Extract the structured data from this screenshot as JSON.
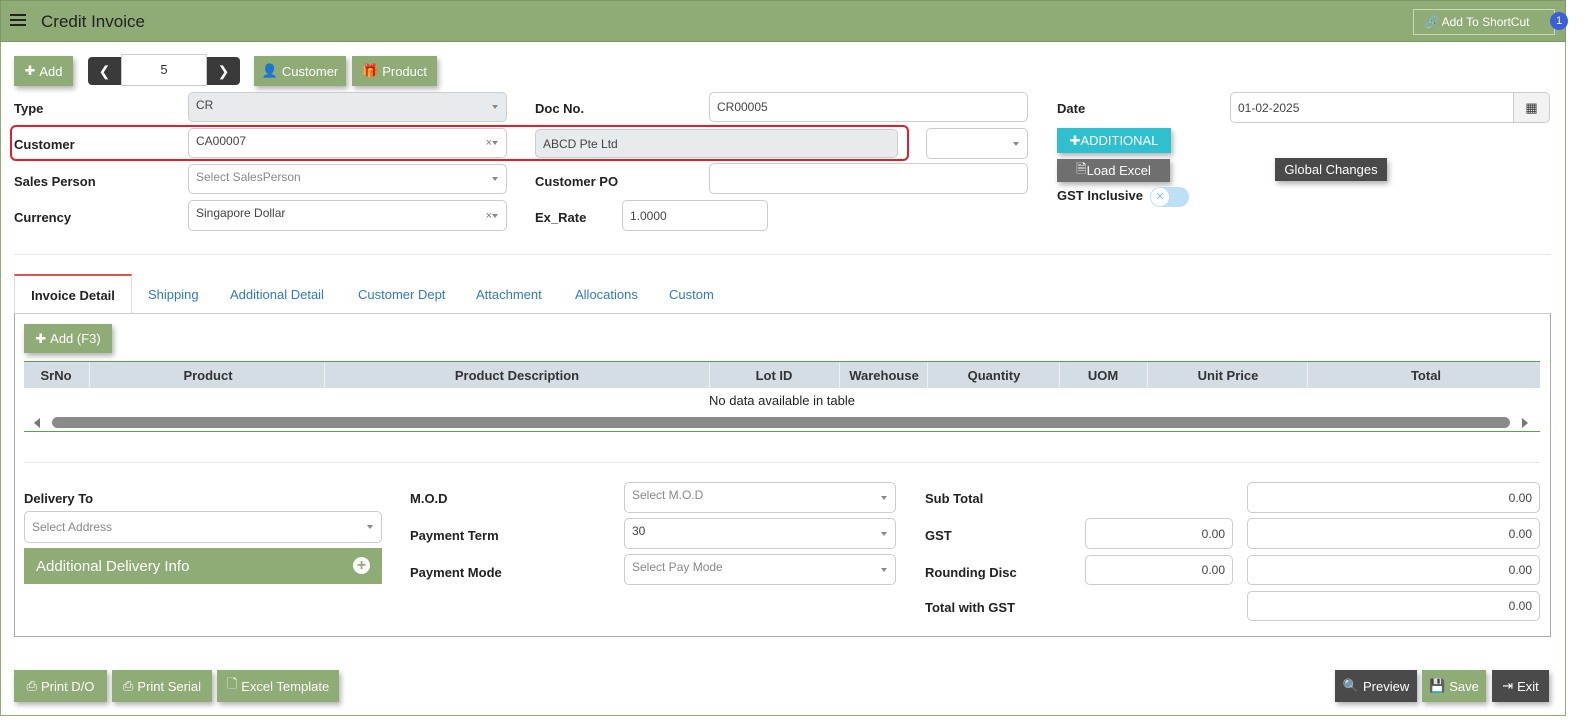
{
  "header": {
    "title": "Credit Invoice",
    "shortcut_label": "Add To ShortCut",
    "badge": "1"
  },
  "toolbar": {
    "add_label": "Add",
    "record_number": "5",
    "customer_label": "Customer",
    "product_label": "Product"
  },
  "form": {
    "type_label": "Type",
    "type_value": "CR",
    "docno_label": "Doc No.",
    "docno_value": "CR00005",
    "date_label": "Date",
    "date_value": "01-02-2025",
    "customer_label": "Customer",
    "customer_code": "CA00007",
    "customer_name": "ABCD Pte Ltd",
    "additional_label": "ADDITIONAL",
    "sales_person_label": "Sales Person",
    "sales_person_placeholder": "Select SalesPerson",
    "customer_po_label": "Customer PO",
    "load_excel_label": "Load Excel",
    "global_changes_label": "Global Changes",
    "gst_inclusive_label": "GST Inclusive",
    "currency_label": "Currency",
    "currency_value": "Singapore Dollar",
    "exrate_label": "Ex_Rate",
    "exrate_value": "1.0000"
  },
  "tabs": [
    "Invoice Detail",
    "Shipping",
    "Additional Detail",
    "Customer Dept",
    "Attachment",
    "Allocations",
    "Custom"
  ],
  "grid": {
    "add_label": "Add (F3)",
    "columns": [
      "SrNo",
      "Product",
      "Product Description",
      "Lot ID",
      "Warehouse",
      "Quantity",
      "UOM",
      "Unit Price",
      "Total"
    ],
    "empty_text": "No data available in table"
  },
  "footer_form": {
    "delivery_label": "Delivery To",
    "delivery_placeholder": "Select Address",
    "additional_delivery_label": "Additional Delivery Info",
    "mod_label": "M.O.D",
    "mod_placeholder": "Select M.O.D",
    "payment_term_label": "Payment Term",
    "payment_term_value": "30",
    "payment_mode_label": "Payment Mode",
    "payment_mode_placeholder": "Select Pay Mode",
    "subtotal_label": "Sub Total",
    "subtotal_value": "0.00",
    "gst_label": "GST",
    "gst_rate_value": "0.00",
    "gst_value": "0.00",
    "rounding_label": "Rounding Disc",
    "rounding_rate_value": "0.00",
    "rounding_value": "0.00",
    "total_gst_label": "Total with GST",
    "total_gst_value": "0.00"
  },
  "actions": {
    "print_do": "Print D/O",
    "print_serial": "Print Serial",
    "excel_template": "Excel Template",
    "preview": "Preview",
    "save": "Save",
    "exit": "Exit"
  }
}
